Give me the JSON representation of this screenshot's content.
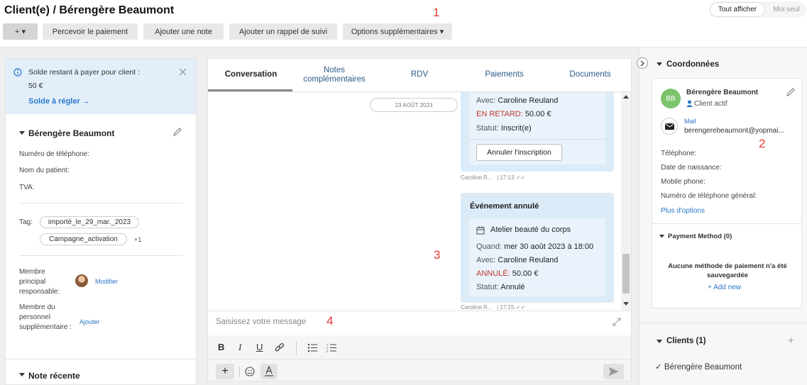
{
  "header": {
    "title": "Client(e) / Bérengère Beaumont",
    "add_label": "+ ▾",
    "buttons": [
      "Percevoir le paiement",
      "Ajouter une note",
      "Ajouter un rappel de suivi",
      "Options supplémentaires ▾"
    ],
    "toggle": {
      "all": "Tout afficher",
      "mine": "Moi seul"
    }
  },
  "markers": [
    "1",
    "2",
    "3",
    "4"
  ],
  "left": {
    "balance": {
      "label": "Solde restant à payer pour client :",
      "amount": "50 €",
      "link": "Solde à régler →"
    },
    "client_name": "Bérengère Beaumont",
    "fields": [
      "Numéro de téléphone:",
      "Nom du patient:",
      "TVA:"
    ],
    "tag_label": "Tag:",
    "tags": [
      "importé_le_29_mar._2023",
      "Campagne_activation"
    ],
    "tags_more": "+1",
    "main_member_label": "Membre principal responsable:",
    "modify": "Modifier",
    "extra_member_label": "Membre du personnel supplémentaire :",
    "add": "Ajouter",
    "recent_note": "Note récente"
  },
  "chat": {
    "tabs": [
      "Conversation",
      "Notes complémentaires",
      "RDV",
      "Paiements",
      "Documents"
    ],
    "date_chip": "23 AOÛT 2023",
    "card1": {
      "with_label": "Avec:",
      "with_value": "Caroline Reuland",
      "late_label": "EN RETARD:",
      "late_value": "50.00 €",
      "status_label": "Statut:",
      "status_value": "Inscrit(e)",
      "cancel_btn": "Annuler l'inscription"
    },
    "meta1": "Caroline R...   | 17:13 ✓✓",
    "card2": {
      "title": "Événement annulé",
      "event": "Atelier beauté du corps",
      "when_label": "Quand:",
      "when_value": "mer 30 août 2023 à 18:00",
      "with_label": "Avec:",
      "with_value": "Caroline Reuland",
      "cancel_label": "ANNULÉ:",
      "cancel_value": "50.00 €",
      "status_label": "Statut:",
      "status_value": "Annulé"
    },
    "meta2": "Caroline R...   | 17:15 ✓✓",
    "placeholder": "Saisissez votre message"
  },
  "right": {
    "section": "Coordonnées",
    "initials": "BB",
    "name": "Bérengère Beaumont",
    "status": "Client actif",
    "mail_label": "Mail",
    "mail_value": "berengerebeaumont@yopmai...",
    "fields": [
      "Téléphone:",
      "Date de naissance:",
      "Mobile phone:",
      "Numéro de téléphone général:"
    ],
    "more": "Plus d'options",
    "payment_title": "Payment Method (0)",
    "payment_empty": "Aucune méthode de paiement n'a été sauvegardée",
    "add_new": "+ Add new",
    "clients_title": "Clients (1)",
    "client_item": "✓ Bérengère Beaumont"
  },
  "colors": {
    "accent": "#2a78c9",
    "card": "#dcebf8",
    "late": "#c0392b",
    "marker": "#e53935"
  }
}
